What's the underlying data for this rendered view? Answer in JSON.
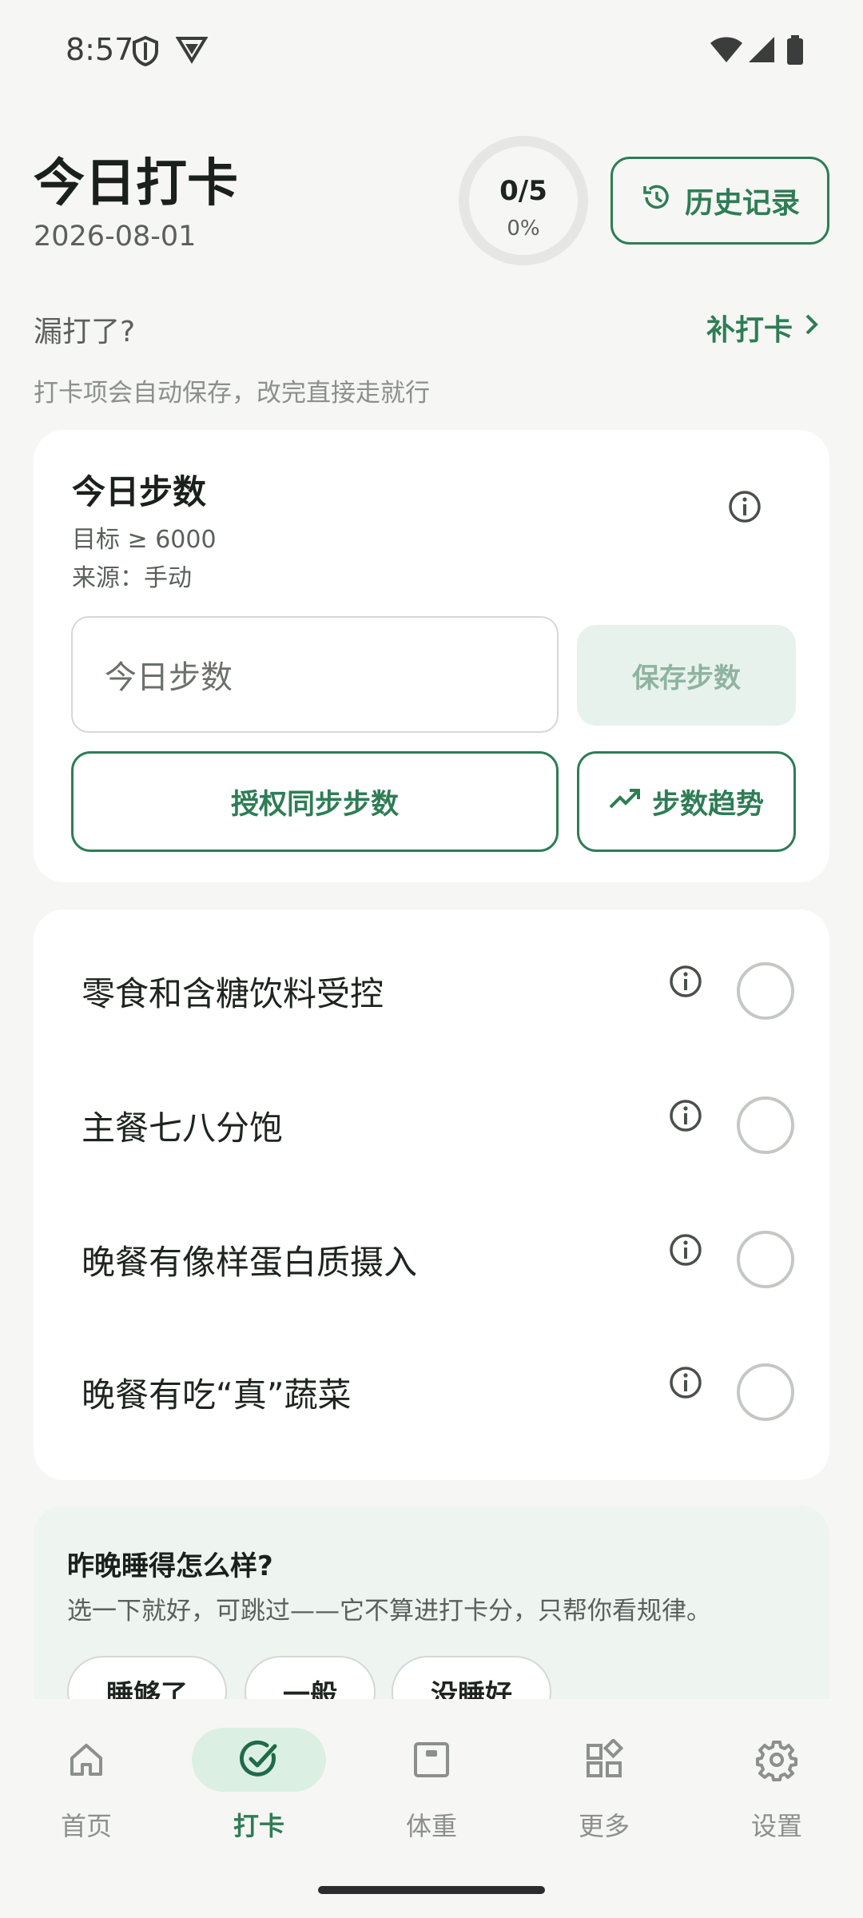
{
  "status_bar": {
    "time": "8:57"
  },
  "header": {
    "title": "今日打卡",
    "date": "2026-08-01",
    "progress_count": "0/5",
    "progress_percent": "0%",
    "progress_fraction": 0,
    "history_button": "历史记录"
  },
  "makeup": {
    "question": "漏打了?",
    "link": "补打卡",
    "hint": "打卡项会自动保存，改完直接走就行"
  },
  "steps": {
    "title": "今日步数",
    "goal": "目标 ≥ 6000",
    "source": "来源：手动",
    "input_placeholder": "今日步数",
    "save_button": "保存步数",
    "sync_button": "授权同步步数",
    "trend_button": "步数趋势"
  },
  "checklist": [
    {
      "label": "零食和含糖饮料受控",
      "checked": false
    },
    {
      "label": "主餐七八分饱",
      "checked": false
    },
    {
      "label": "晚餐有像样蛋白质摄入",
      "checked": false
    },
    {
      "label": "晚餐有吃“真”蔬菜",
      "checked": false
    }
  ],
  "sleep": {
    "question": "昨晚睡得怎么样?",
    "subtitle": "选一下就好，可跳过——它不算进打卡分，只帮你看规律。",
    "options": [
      "睡够了",
      "一般",
      "没睡好"
    ]
  },
  "nav": {
    "items": [
      {
        "label": "首页",
        "icon": "home-icon"
      },
      {
        "label": "打卡",
        "icon": "check-circle-icon",
        "active": true
      },
      {
        "label": "体重",
        "icon": "scale-icon"
      },
      {
        "label": "更多",
        "icon": "apps-icon"
      },
      {
        "label": "设置",
        "icon": "gear-icon"
      }
    ]
  },
  "colors": {
    "accent": "#2e7d55",
    "background": "#f6f6f4",
    "card": "#ffffff"
  }
}
